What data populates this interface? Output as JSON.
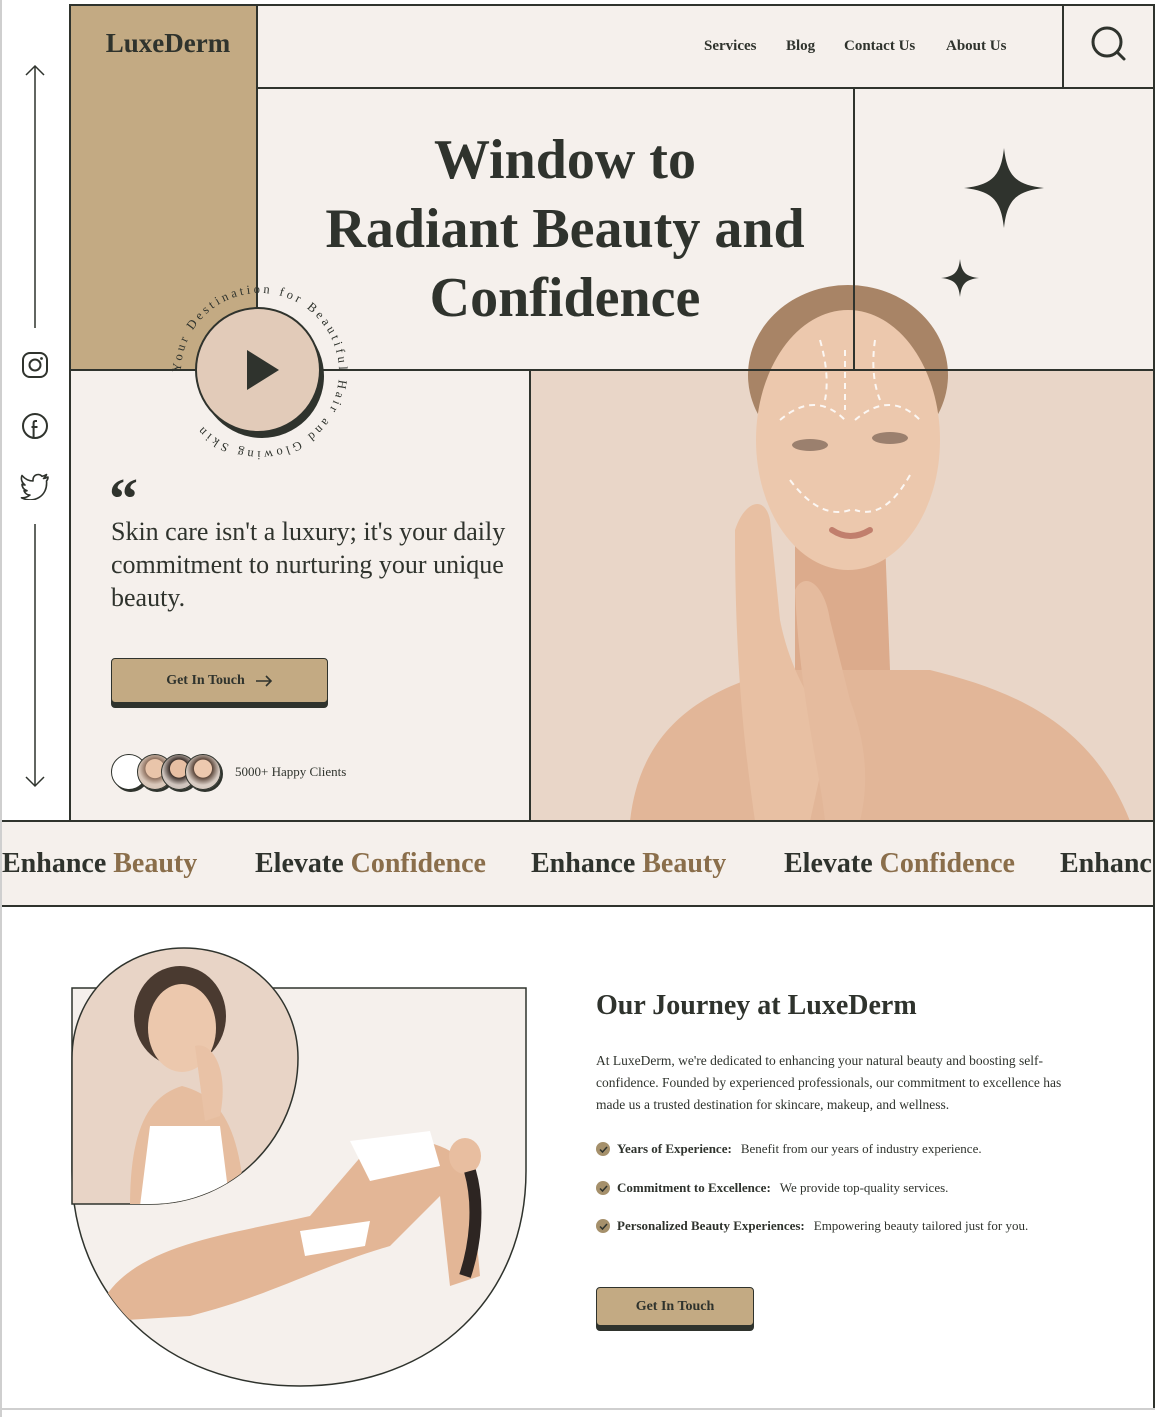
{
  "brand": {
    "logo": "LuxeDerm"
  },
  "nav": {
    "items": [
      {
        "label": "Services"
      },
      {
        "label": "Blog"
      },
      {
        "label": "Contact Us"
      },
      {
        "label": "About Us"
      }
    ]
  },
  "icons": {
    "search": "search-icon",
    "scroll_up": "arrow-up-icon",
    "scroll_down": "arrow-down-icon",
    "instagram": "instagram-icon",
    "facebook": "facebook-icon",
    "twitter": "twitter-icon",
    "play": "play-icon",
    "sparkle": "sparkle-icon",
    "quote": "quote-icon",
    "arrow": "arrow-right-icon",
    "check": "check-icon"
  },
  "hero": {
    "title_line1": "Window to",
    "title_line2": "Radiant Beauty and",
    "title_line3": "Confidence",
    "circle_text": "Your Destination for Beautiful Hair and Glowing Skin",
    "quote_mark": "“",
    "quote": "Skin care isn't a luxury; it's your daily commitment to nurturing your unique beauty.",
    "cta_label": "Get In Touch",
    "clients_label": "5000+ Happy Clients"
  },
  "marquee": [
    {
      "word1": "Enhance",
      "word2": "Beauty"
    },
    {
      "word1": "Elevate",
      "word2": "Confidence"
    },
    {
      "word1": "Enhance",
      "word2": "Beauty"
    },
    {
      "word1": "Elevate",
      "word2": "Confidence"
    },
    {
      "word1": "Enhanc",
      "word2": ""
    }
  ],
  "about": {
    "title": "Our Journey at LuxeDerm",
    "body": "At LuxeDerm, we're dedicated to enhancing your natural beauty and boosting self-confidence. Founded by experienced professionals, our commitment to excellence has made us a trusted destination for skincare, makeup, and wellness.",
    "features": [
      {
        "title": "Years of Experience:",
        "text": "Benefit from our years of industry experience."
      },
      {
        "title": "Commitment to Excellence:",
        "text": "We provide top-quality services."
      },
      {
        "title": "Personalized Beauty Experiences:",
        "text": "Empowering beauty tailored just for you."
      }
    ],
    "cta_label": "Get In Touch"
  },
  "colors": {
    "dark": "#2f332d",
    "tan": "#c3aa83",
    "cream": "#f5f0ec",
    "blush": "#e8d4c6",
    "accent_text": "#8a6e4b"
  }
}
